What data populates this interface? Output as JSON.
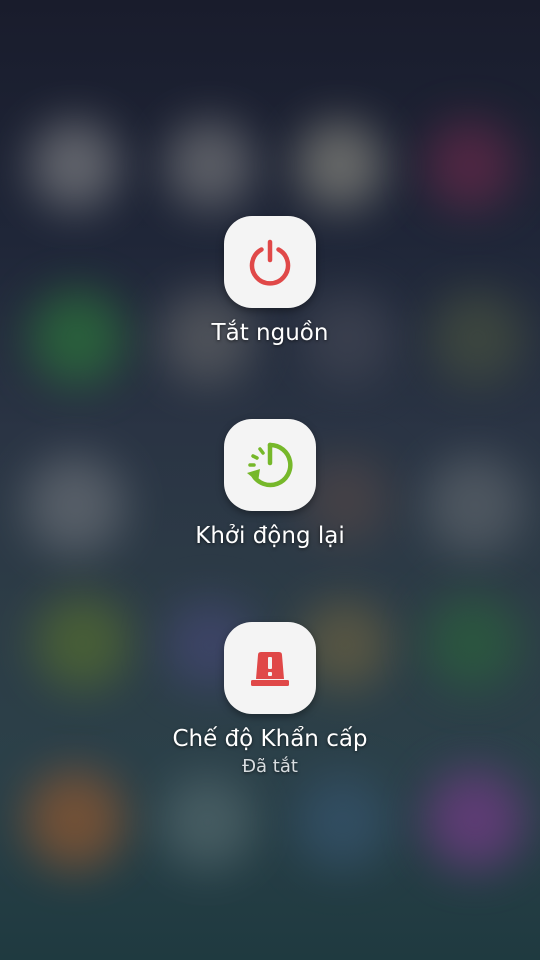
{
  "power_menu": {
    "power_off": {
      "label": "Tắt nguồn",
      "icon": "power-icon",
      "icon_color": "#e04848"
    },
    "restart": {
      "label": "Khởi động lại",
      "icon": "restart-icon",
      "icon_color": "#76b82a"
    },
    "emergency": {
      "label": "Chế độ Khẩn cấp",
      "status": "Đã tắt",
      "icon": "emergency-siren-icon",
      "icon_color": "#e04848"
    }
  }
}
